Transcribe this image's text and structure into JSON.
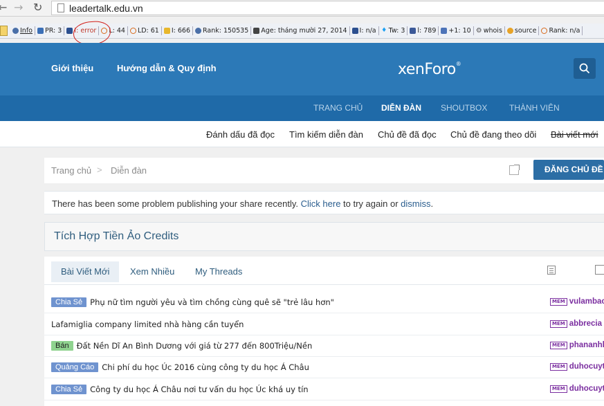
{
  "browser": {
    "back_icon": "back-arrow-icon",
    "forward_icon": "forward-arrow-icon",
    "reload_icon": "reload-icon",
    "url": "leadertalk.edu.vn"
  },
  "seo_toolbar": {
    "items": [
      {
        "icon": "info-icon",
        "label": "Info"
      },
      {
        "icon": "pagerank-icon",
        "label": "PR: 3"
      },
      {
        "icon": "index-icon",
        "label": "I: error"
      },
      {
        "icon": "links-icon",
        "label": "L: 44"
      },
      {
        "icon": "linkdomain-icon",
        "label": "LD: 61"
      },
      {
        "icon": "bing-index-icon",
        "label": "I: 666"
      },
      {
        "icon": "alexa-icon",
        "label": "Rank: 150535"
      },
      {
        "icon": "age-icon",
        "label": "Age: tháng mười 27, 2014"
      },
      {
        "icon": "delicious-icon",
        "label": "I: n/a"
      },
      {
        "icon": "twitter-icon",
        "label": "Tw: 3"
      },
      {
        "icon": "facebook-icon",
        "label": "l: 789"
      },
      {
        "icon": "gplus-icon",
        "label": "+1: 10"
      },
      {
        "icon": "whois-icon",
        "label": "whois"
      },
      {
        "icon": "source-icon",
        "label": "source"
      },
      {
        "icon": "rank-icon",
        "label": "Rank: n/a"
      }
    ]
  },
  "header": {
    "links": [
      "Giới thiệu",
      "Hướng dẫn & Quy định"
    ],
    "logo_main": "xenForo",
    "logo_mark": "®",
    "search_icon": "search-icon",
    "color": "#2c79b7"
  },
  "main_nav": {
    "tabs": [
      "TRANG CHỦ",
      "DIỄN ĐÀN",
      "SHOUTBOX",
      "THÀNH VIÊN"
    ],
    "active": "DIỄN ĐÀN"
  },
  "sub_nav": {
    "links": [
      "Đánh dấu đã đọc",
      "Tìm kiếm diễn đàn",
      "Chủ đề đã đọc",
      "Chủ đề đang theo dõi",
      "Bài viết mới"
    ]
  },
  "breadcrumb": {
    "items": [
      "Trang chủ",
      "Diễn đàn"
    ],
    "separator": ">",
    "post_button": "ĐĂNG CHỦ ĐỀ"
  },
  "notice": {
    "text_before": "There has been some problem publishing your share recently. ",
    "link_1": "Click here",
    "text_middle": " to try again or ",
    "link_2": "dismiss",
    "text_after": "."
  },
  "block": {
    "title": "Tích Hợp Tiền Ảo Credits"
  },
  "threads": {
    "tabs": [
      "Bài Viết Mới",
      "Xem Nhiều",
      "My Threads"
    ],
    "active_tab": "Bài Viết Mới",
    "badge_label": "MEM",
    "rows": [
      {
        "prefix": "Chia Sẻ",
        "prefix_style": "blue",
        "title": "Phụ nữ tìm người yêu và tìm chồng cùng quê sẽ \"trẻ lâu hơn\"",
        "user": "vulambao"
      },
      {
        "prefix": "",
        "prefix_style": "",
        "title": "Lafamiglia company limited nhà hàng cần tuyển",
        "user": "abbrecia"
      },
      {
        "prefix": "Bán",
        "prefix_style": "green",
        "title": "Đất Nền Dĩ An Bình Dương với giá từ 277 đến 800Triệu/Nền",
        "user": "phananhh"
      },
      {
        "prefix": "Quảng Cáo",
        "prefix_style": "blue",
        "title": "Chi phí du học Úc 2016 cùng công ty du học Á Châu",
        "user": "duhocuyt"
      },
      {
        "prefix": "Chia Sẻ",
        "prefix_style": "blue",
        "title": "Công ty du học Á Châu nơi tư vấn du học Úc khá uy tín",
        "user": "duhocuyt"
      }
    ]
  }
}
